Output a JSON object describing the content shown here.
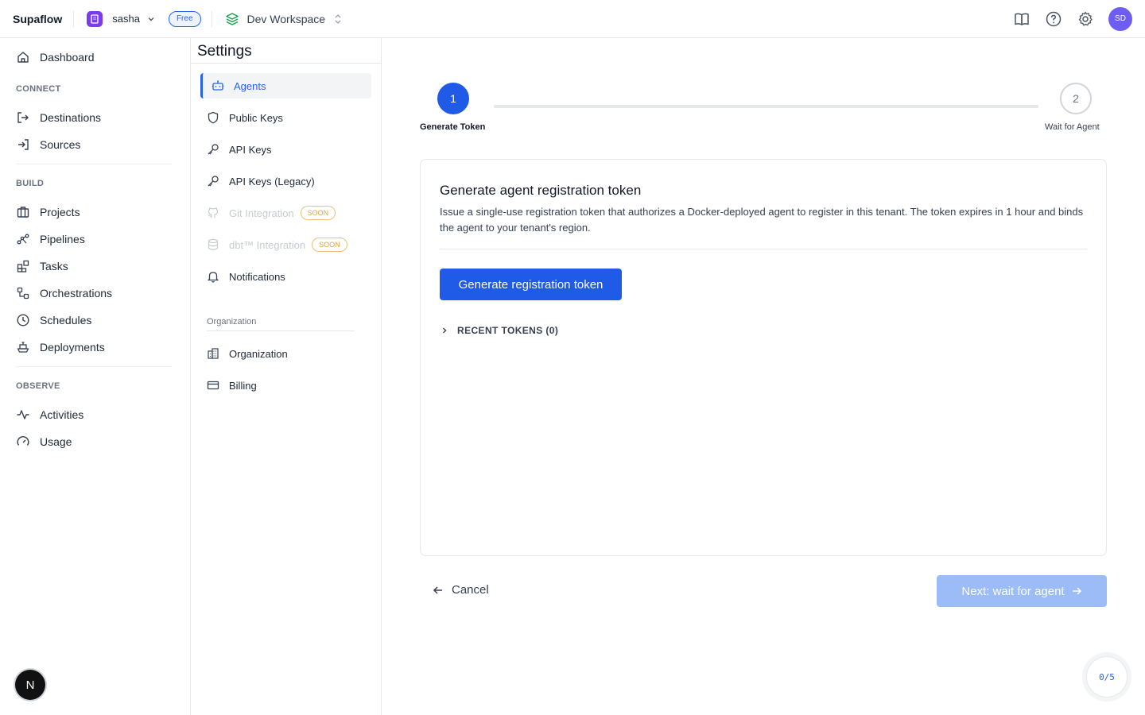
{
  "topbar": {
    "brand": "Supaflow",
    "org_name": "sasha",
    "plan_badge": "Free",
    "workspace": "Dev Workspace",
    "user_initials": "SD",
    "colors": {
      "accent": "#1f5be6",
      "org_avatar": "#7c3aed",
      "user_avatar": "#6d5df5"
    }
  },
  "sidebar": {
    "dashboard": "Dashboard",
    "sections": {
      "connect": "CONNECT",
      "build": "BUILD",
      "observe": "OBSERVE"
    },
    "connect_items": [
      "Destinations",
      "Sources"
    ],
    "build_items": [
      "Projects",
      "Pipelines",
      "Tasks",
      "Orchestrations",
      "Schedules",
      "Deployments"
    ],
    "observe_items": [
      "Activities",
      "Usage"
    ],
    "bottom_button": "N"
  },
  "settings": {
    "title": "Settings",
    "items": [
      {
        "label": "Agents",
        "icon": "robot-icon",
        "active": true
      },
      {
        "label": "Public Keys",
        "icon": "shield-icon"
      },
      {
        "label": "API Keys",
        "icon": "key-icon"
      },
      {
        "label": "API Keys (Legacy)",
        "icon": "key-icon"
      },
      {
        "label": "Git Integration",
        "icon": "github-icon",
        "badge": "SOON",
        "disabled": true
      },
      {
        "label": "dbt™ Integration",
        "icon": "database-icon",
        "badge": "SOON",
        "disabled": true
      },
      {
        "label": "Notifications",
        "icon": "bell-icon"
      }
    ],
    "org_section_label": "Organization",
    "org_items": [
      {
        "label": "Organization",
        "icon": "building-icon"
      },
      {
        "label": "Billing",
        "icon": "credit-card-icon"
      }
    ]
  },
  "stepper": {
    "step1_number": "1",
    "step1_label": "Generate Token",
    "step2_number": "2",
    "step2_label": "Wait for Agent"
  },
  "card": {
    "title": "Generate agent registration token",
    "description": "Issue a single-use registration token that authorizes a Docker-deployed agent to register in this tenant. The token expires in 1 hour and binds the agent to your tenant's region.",
    "generate_button": "Generate registration token",
    "recent_tokens": "RECENT TOKENS (0)"
  },
  "footer": {
    "cancel": "Cancel",
    "next": "Next: wait for agent"
  },
  "progress": {
    "text": "0/5"
  }
}
